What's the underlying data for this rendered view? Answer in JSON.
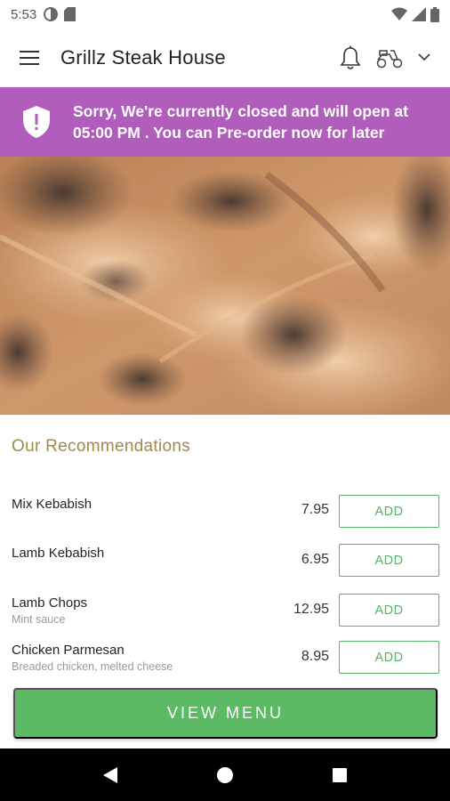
{
  "status_bar": {
    "time": "5:53"
  },
  "app_bar": {
    "title": "Grillz Steak House"
  },
  "banner": {
    "message": "Sorry, We're currently closed and will open at 05:00 PM . You can Pre-order now for later",
    "color": "#b05dbc"
  },
  "recommendations": {
    "title": "Our Recommendations",
    "items": [
      {
        "name": "Mix Kebabish",
        "description": "",
        "price": "7.95",
        "button": "ADD"
      },
      {
        "name": "Lamb Kebabish",
        "description": "",
        "price": "6.95",
        "button": "ADD"
      },
      {
        "name": "Lamb Chops",
        "description": "Mint sauce",
        "price": "12.95",
        "button": "ADD"
      },
      {
        "name": "Chicken Parmesan",
        "description": "Breaded chicken, melted cheese",
        "price": "8.95",
        "button": "ADD"
      }
    ]
  },
  "view_menu_label": "VIEW MENU",
  "colors": {
    "accent_green": "#5cb964",
    "section_title": "#9e8a4e"
  }
}
